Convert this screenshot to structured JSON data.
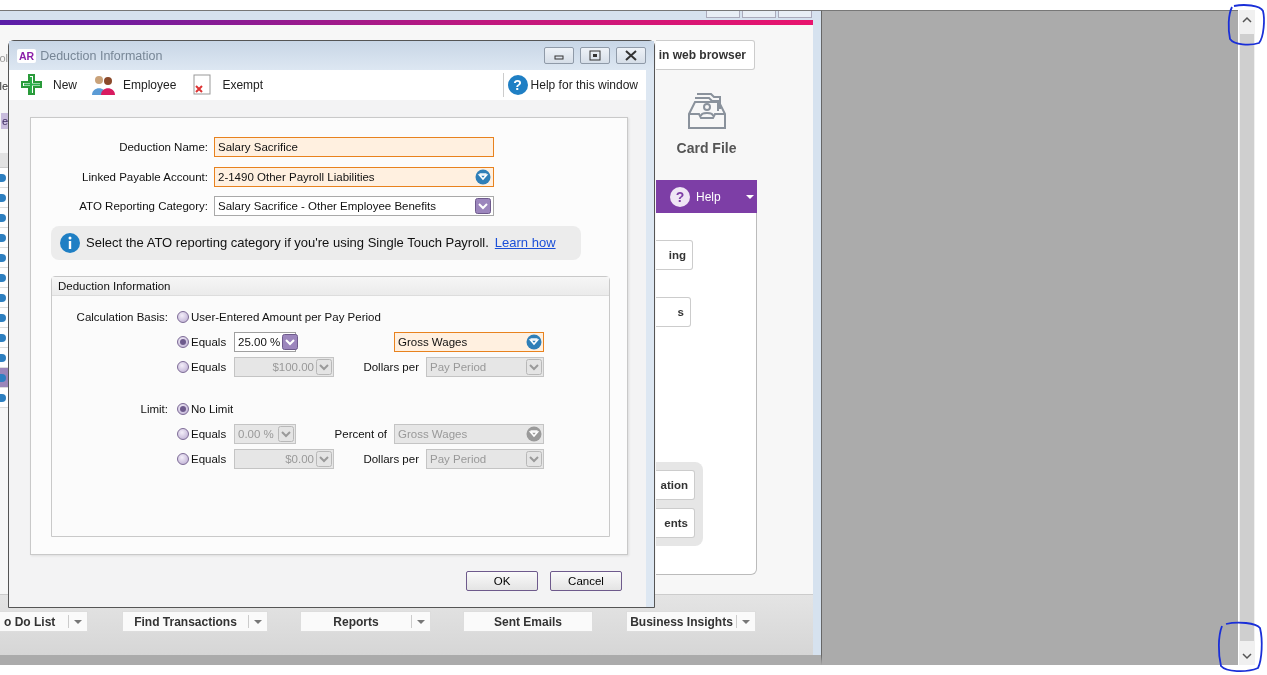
{
  "app": {
    "left_list": {
      "texts": [
        "ol",
        "le"
      ],
      "tab": "e",
      "rows": [
        {
          "selected": false
        },
        {
          "selected": false
        },
        {
          "selected": false
        },
        {
          "selected": false
        },
        {
          "selected": false
        },
        {
          "selected": false
        },
        {
          "selected": false
        },
        {
          "selected": false
        },
        {
          "selected": false
        },
        {
          "selected": false
        },
        {
          "selected": true
        },
        {
          "selected": false
        }
      ]
    },
    "web_button": "in web browser",
    "card_file": "Card File",
    "help_icon": "?",
    "help": "Help",
    "panel_buttons": [
      "ing",
      "s"
    ],
    "group_buttons": [
      "ation",
      "ents"
    ],
    "bottom_bar": [
      {
        "label": "o Do List",
        "dropdown": true
      },
      {
        "label": "Find Transactions",
        "dropdown": true
      },
      {
        "label": "Reports",
        "dropdown": true
      },
      {
        "label": "Sent Emails",
        "dropdown": false
      },
      {
        "label": "Business Insights",
        "dropdown": true
      }
    ]
  },
  "dialog": {
    "logo": "AR",
    "title": "Deduction Information",
    "toolbar": [
      {
        "label": "New"
      },
      {
        "label": "Employee"
      },
      {
        "label": "Exempt"
      }
    ],
    "help_icon": "?",
    "help": "Help for this window",
    "fields": [
      {
        "label": "Deduction Name:",
        "value": "Salary Sacrifice",
        "kind": "text",
        "highlighted": true
      },
      {
        "label": "Linked Payable Account:",
        "value": "2-1490 Other Payroll Liabilities",
        "kind": "lookup",
        "highlighted": true
      },
      {
        "label": "ATO Reporting Category:",
        "value": "Salary Sacrifice - Other Employee Benefits",
        "kind": "dropdown",
        "highlighted": false
      }
    ],
    "info": {
      "text": "Select the ATO reporting category if you're using Single Touch Payroll.",
      "link": "Learn how"
    },
    "group": {
      "title": "Deduction Information",
      "sections": [
        {
          "label": "Calculation Basis:",
          "options": [
            {
              "label": "User-Entered Amount per Pay Period",
              "selected": false,
              "kind": "plain"
            },
            {
              "label": "Equals",
              "selected": true,
              "kind": "percent",
              "amount": "25.00 %",
              "disabled": false,
              "base": "Gross Wages",
              "highlighted": true
            },
            {
              "label": "Equals",
              "selected": false,
              "kind": "dollar",
              "amount": "$100.00",
              "disabled": true,
              "per_label": "Dollars per",
              "base": "Pay Period",
              "highlighted": false
            }
          ]
        },
        {
          "label": "Limit:",
          "options": [
            {
              "label": "No Limit",
              "selected": true,
              "kind": "plain"
            },
            {
              "label": "Equals",
              "selected": false,
              "kind": "percent",
              "amount": "0.00 %",
              "disabled": true,
              "per_label": "Percent of",
              "base": "Gross Wages",
              "highlighted": false
            },
            {
              "label": "Equals",
              "selected": false,
              "kind": "dollar",
              "amount": "$0.00",
              "disabled": true,
              "per_label": "Dollars per",
              "base": "Pay Period",
              "highlighted": false
            }
          ]
        }
      ]
    },
    "buttons": [
      "OK",
      "Cancel"
    ]
  }
}
